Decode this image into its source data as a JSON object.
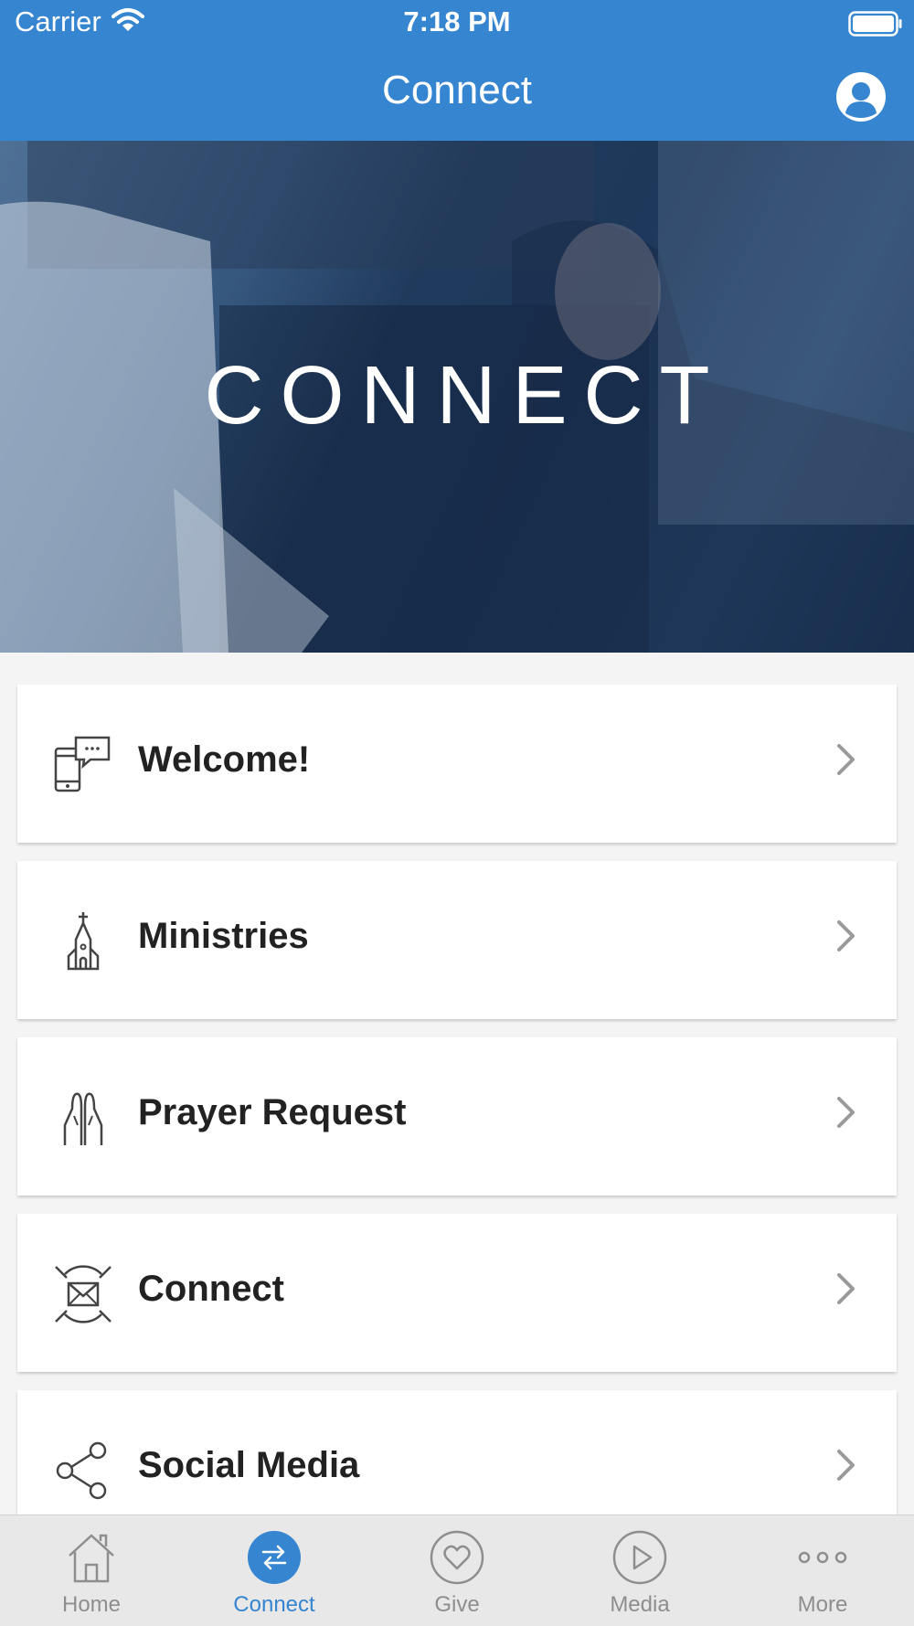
{
  "status_bar": {
    "carrier": "Carrier",
    "time": "7:18 PM"
  },
  "nav": {
    "title": "Connect"
  },
  "hero": {
    "title": "CONNECT"
  },
  "menu": [
    {
      "label": "Welcome!",
      "icon": "phone-chat-icon"
    },
    {
      "label": "Ministries",
      "icon": "church-icon"
    },
    {
      "label": "Prayer Request",
      "icon": "praying-hands-icon"
    },
    {
      "label": "Connect",
      "icon": "envelope-icon"
    },
    {
      "label": "Social Media",
      "icon": "share-icon"
    }
  ],
  "tabs": [
    {
      "label": "Home",
      "icon": "home-icon"
    },
    {
      "label": "Connect",
      "icon": "swap-arrows-icon",
      "active": true
    },
    {
      "label": "Give",
      "icon": "heart-icon"
    },
    {
      "label": "Media",
      "icon": "play-icon"
    },
    {
      "label": "More",
      "icon": "more-dots-icon"
    }
  ],
  "colors": {
    "primary": "#3585d0",
    "tab_inactive": "#8e8e8e",
    "text": "#222222"
  }
}
